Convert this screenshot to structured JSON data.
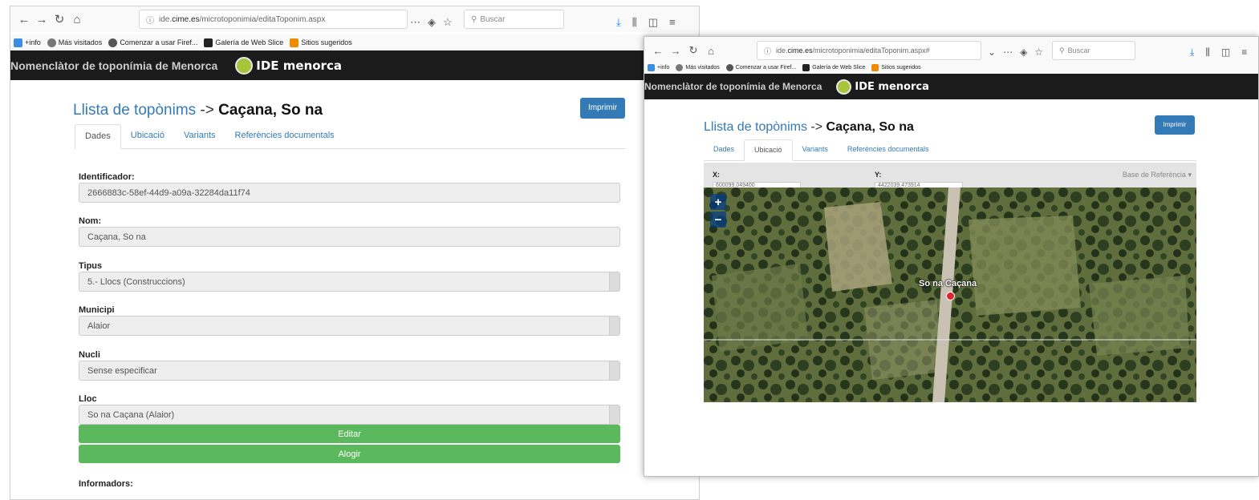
{
  "left": {
    "url_prefix": "ide.",
    "url_domain": "cime.es",
    "url_path": "/microtoponimia/editaToponim.aspx",
    "search_placeholder": "Buscar",
    "bookmarks": [
      "+info",
      "Más visitados",
      "Comenzar a usar Firef...",
      "Galería de Web Slice",
      "Sitios sugeridos"
    ],
    "site_title": "Nomenclàtor de toponímia de Menorca",
    "logo": "IDE menorca",
    "breadcrumb_link": "Llista de topònims",
    "breadcrumb_sep": " -> ",
    "breadcrumb_current": "Caçana, So na",
    "print": "Imprimir",
    "tabs": [
      "Dades",
      "Ubicació",
      "Variants",
      "Referències documentals"
    ],
    "fields": [
      {
        "label": "Identificador:",
        "value": "2666883c-58ef-44d9-a09a-32284da11f74"
      },
      {
        "label": "Nom:",
        "value": "Caçana, So na"
      },
      {
        "label": "Tipus",
        "value": "5.- Llocs (Construccions)"
      },
      {
        "label": "Municipi",
        "value": "Alaior"
      },
      {
        "label": "Nucli",
        "value": "Sense especificar"
      },
      {
        "label": "Lloc",
        "value": "So na Caçana (Alaior)"
      }
    ],
    "edit": "Editar",
    "delete": "Alogir",
    "informadors": "Informadors:"
  },
  "right": {
    "url_prefix": "ide.",
    "url_domain": "cime.es",
    "url_path": "/microtoponimia/editaToponim.aspx#",
    "search_placeholder": "Buscar",
    "bookmarks": [
      "+info",
      "Más visitados",
      "Comenzar a usar Firef...",
      "Galería de Web Slice",
      "Sitios sugeridos"
    ],
    "site_title": "Nomenclàtor de toponímia de Menorca",
    "logo": "IDE menorca",
    "breadcrumb_link": "Llista de topònims",
    "breadcrumb_sep": " -> ",
    "breadcrumb_current": "Caçana, So na",
    "print": "Imprimir",
    "tabs": [
      "Dades",
      "Ubicació",
      "Variants",
      "Referències documentals"
    ],
    "x_label": "X:",
    "y_label": "Y:",
    "x_value": "600099.049400",
    "y_value": "4422039.473914",
    "base_ref": "Base de Referència",
    "zoom_in": "+",
    "zoom_out": "−",
    "map_label": "So na Caçana"
  },
  "colors": {
    "link": "#337ab7",
    "green": "#5cb85c",
    "dark": "#1b1b1b",
    "pin": "#e0242c"
  }
}
